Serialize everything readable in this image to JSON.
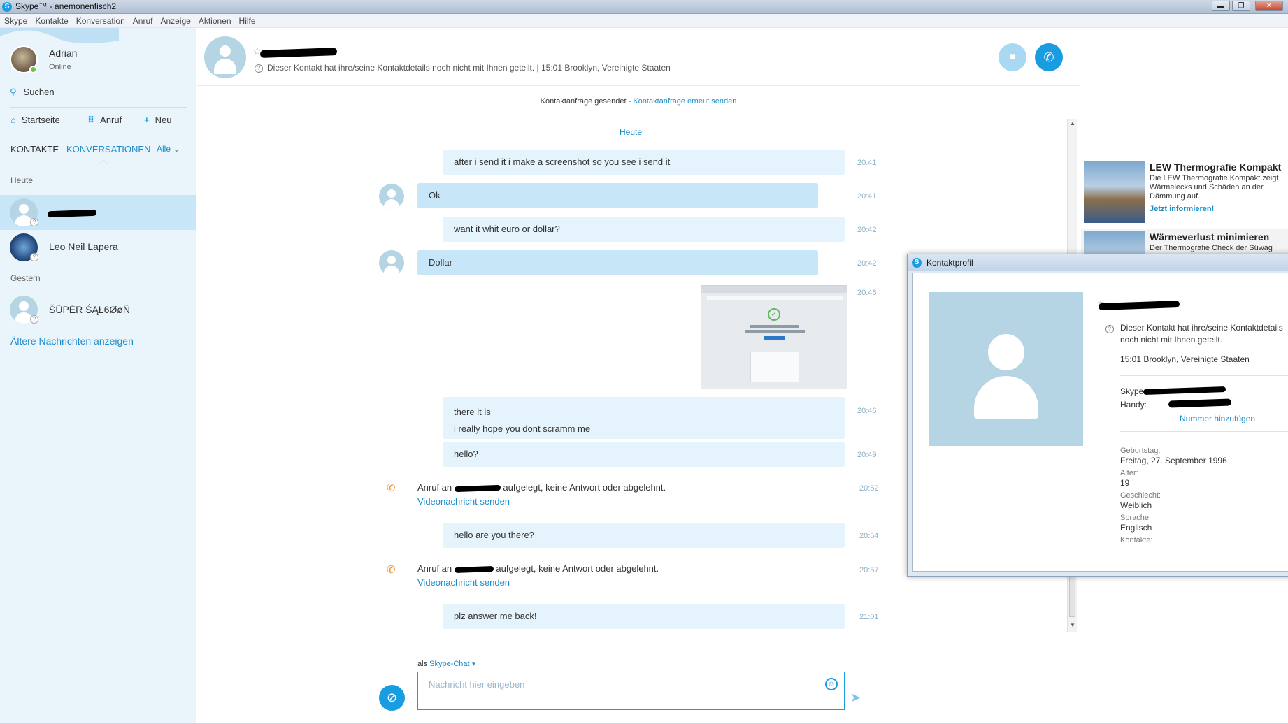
{
  "window": {
    "title": "Skype™ - anemonenfisch2",
    "min": "▬",
    "max": "❐",
    "close": "✕"
  },
  "menu": [
    "Skype",
    "Kontakte",
    "Konversation",
    "Anruf",
    "Anzeige",
    "Aktionen",
    "Hilfe"
  ],
  "user": {
    "name": "Adrian",
    "status": "Online"
  },
  "sidebar": {
    "search": "Suchen",
    "nav": {
      "home": "Startseite",
      "call": "Anruf",
      "new": "Neu"
    },
    "tabs": {
      "contacts": "KONTAKTE",
      "conversations": "KONVERSATIONEN",
      "filter": "Alle"
    },
    "sections": {
      "today": "Heute",
      "yesterday": "Gestern"
    },
    "contacts": [
      {
        "name": "",
        "active": true
      },
      {
        "name": "Leo Neil Lapera"
      },
      {
        "name": "ŠÜPÉR ŚĄŁ6ØøÑ"
      }
    ],
    "older": "Ältere Nachrichten anzeigen"
  },
  "conversation": {
    "info": "Dieser Kontakt hat ihre/seine Kontaktdetails noch nicht mit Ihnen geteilt.  |  15:01 Brooklyn, Vereinigte Staaten",
    "request_sent": "Kontaktanfrage gesendet - ",
    "request_resend": "Kontaktanfrage erneut senden",
    "day": "Heute",
    "messages": [
      {
        "text": "after i send it i make a screenshot so you see i send it",
        "time": "20:41"
      },
      {
        "text": "Ok",
        "time": "20:41"
      },
      {
        "text": "want it whit euro or dollar?",
        "time": "20:42"
      },
      {
        "text": "Dollar",
        "time": "20:42"
      },
      {
        "text": "",
        "time": "20:46"
      },
      {
        "line1": "there it is",
        "line2": "i really hope you dont scramm me",
        "time": "20:46"
      },
      {
        "text": "hello?",
        "time": "20:49"
      },
      {
        "call": "Anruf an",
        "call_rest": "aufgelegt, keine Antwort oder abgelehnt.",
        "link": "Videonachricht senden",
        "time": "20:52"
      },
      {
        "text": "hello are you there?",
        "time": "20:54"
      },
      {
        "call": "Anruf an",
        "call_rest": "aufgelegt, keine Antwort oder abgelehnt.",
        "link": "Videonachricht senden",
        "time": "20:57"
      },
      {
        "text": "plz answer me back!",
        "time": "21:01"
      }
    ],
    "compose": {
      "als": "als ",
      "mode": "Skype-Chat ▾",
      "placeholder": "Nachricht hier eingeben"
    }
  },
  "ads": [
    {
      "title": "LEW Thermografie Kompakt",
      "text": "Die LEW Thermografie Kompakt zeigt Wärmelecks und Schäden an der Dämmung auf.",
      "link": "Jetzt informieren!"
    },
    {
      "title": "Wärmeverlust minimieren",
      "text": "Der Thermografie Check der Süwag"
    }
  ],
  "profile": {
    "title": "Kontaktprofil",
    "notice": "Dieser Kontakt hat ihre/seine Kontaktdetails noch nicht mit Ihnen geteilt.",
    "location": "15:01 Brooklyn, Vereinigte Staaten",
    "skype_label": "Skype:",
    "phone_label": "Handy:",
    "add_number": "Nummer hinzufügen",
    "birthday_label": "Geburtstag:",
    "birthday": "Freitag, 27. September 1996",
    "age_label": "Alter:",
    "age": "19",
    "gender_label": "Geschlecht:",
    "gender": "Weiblich",
    "language_label": "Sprache:",
    "language": "Englisch",
    "contacts_label": "Kontakte:"
  },
  "colors": {
    "accent": "#1a9ce0",
    "bubble_out": "#e5f4fc",
    "bubble_in": "#c7e6f8",
    "sidebar": "#eaf4fb"
  }
}
